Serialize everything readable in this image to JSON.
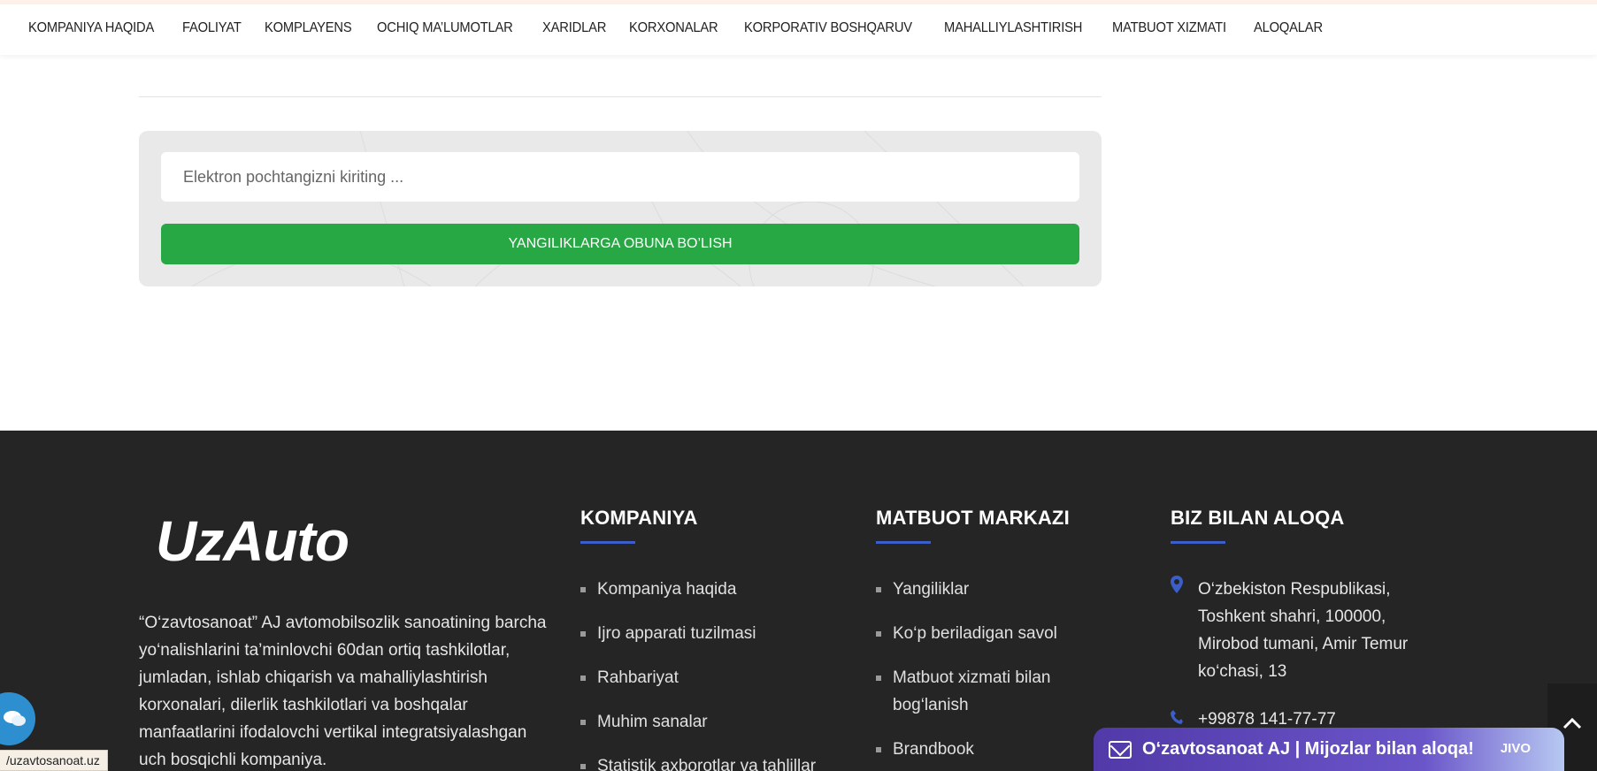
{
  "nav": {
    "items": [
      "KOMPANIYA HAQIDA",
      "FAOLIYAT",
      "KOMPLAYENS",
      "OCHIQ MA’LUMOTLAR",
      "XARIDLAR",
      "KORXONALAR",
      "KORPORATIV BOSHQARUV",
      "MAHALLIYLASHTIRISH",
      "MATBUOT XIZMATI",
      "ALOQALAR"
    ]
  },
  "subscribe": {
    "placeholder": "Elektron pochtangizni kiriting ...",
    "button_label": "YANGILIKLARGA OBUNA BO’LISH"
  },
  "footer": {
    "logo_text": "UzAuto",
    "about": "“O‘zavtosanoat” AJ avtomobilsozlik sanoatining barcha yo‘nalishlarini ta’minlovchi 60dan ortiq tashkilotlar, jumladan, ishlab chiqarish va mahalliylashtirish korxonalari, dilerlik tashkilotlari va boshqalar manfaatlarini ifodalovchi vertikal integratsiyalashgan uch bosqichli kompaniya.",
    "company": {
      "title": "KOMPANIYA",
      "links": [
        "Kompaniya haqida",
        "Ijro apparati tuzilmasi",
        "Rahbariyat",
        "Muhim sanalar",
        "Statistik axborotlar va tahlillar"
      ]
    },
    "press": {
      "title": "MATBUOT MARKAZI",
      "links": [
        "Yangiliklar",
        "Ko‘p beriladigan savol",
        "Matbuot xizmati bilan bog‘lanish",
        "Brandbook"
      ]
    },
    "contact": {
      "title": "BIZ BILAN ALOQA",
      "address": "O‘zbekiston Respublikasi, Toshkent shahri, 100000, Mirobod tumani, Amir Temur ko‘chasi, 13",
      "phone": "+99878 141-77-77"
    }
  },
  "widgets": {
    "status_url": "/uzavtosanoat.uz",
    "jivo_label": "O‘zavtosanoat AJ | Mijozlar bilan aloqa!",
    "jivo_brand": "JIVO",
    "scroll_top_icon": "chevron-up-icon",
    "chat_icon": "chat-bubbles-icon"
  },
  "colors": {
    "accent_green": "#28a745",
    "footer_bg": "#252525",
    "heading_bar": "#3b5ec9",
    "jivo_purple": "#5139a8"
  }
}
